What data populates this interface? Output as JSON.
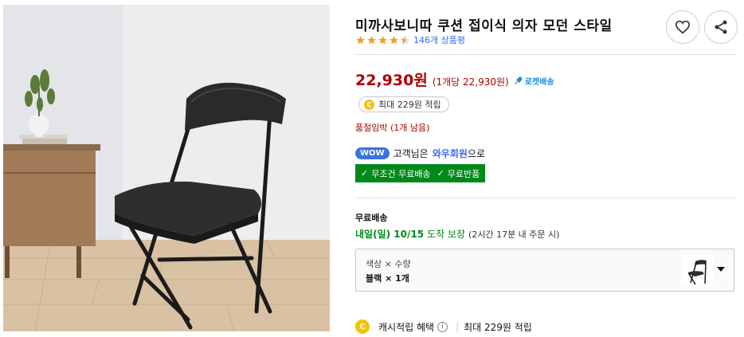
{
  "product": {
    "title": "미까사보니따 쿠션 접이식 의자 모던 스타일",
    "image_alt": "black folding chair product photo",
    "rating": 4.5,
    "review_count_label": "146개 상품평"
  },
  "actions": {
    "wishlist_icon": "heart-icon",
    "share_icon": "share-icon"
  },
  "price": {
    "sale_price": "22,930원",
    "unit_price": "(1개당 22,930원)",
    "delivery_badge": "로켓배송"
  },
  "reward": {
    "coin_glyph": "C",
    "label": "최대 229원 적립"
  },
  "stock": {
    "notice": "품절임박 (1개 남음)"
  },
  "wow": {
    "badge": "WOW",
    "prefix": "고객님은",
    "member": "와우회원",
    "suffix": "으로",
    "benefit_1": "무조건 무료배송",
    "benefit_2": "무료반품",
    "check_glyph": "✓"
  },
  "shipping": {
    "label": "무료배송",
    "date": "내일(일) 10/15",
    "guarantee": "도착 보장",
    "note": "(2시간 17분 내 주문 시)"
  },
  "option": {
    "header": "색상 × 수량",
    "value": "블랙 × 1개"
  },
  "cashback": {
    "coin_glyph": "C",
    "label": "캐시적립 혜택",
    "info_glyph": "i",
    "separator": "|",
    "amount": "최대 229원 적립"
  },
  "colors": {
    "price_red": "#ae0000",
    "wow_blue": "#346aff",
    "benefit_green": "#00891a",
    "star_orange": "#f29d2b",
    "coin_yellow": "#f5c300"
  }
}
